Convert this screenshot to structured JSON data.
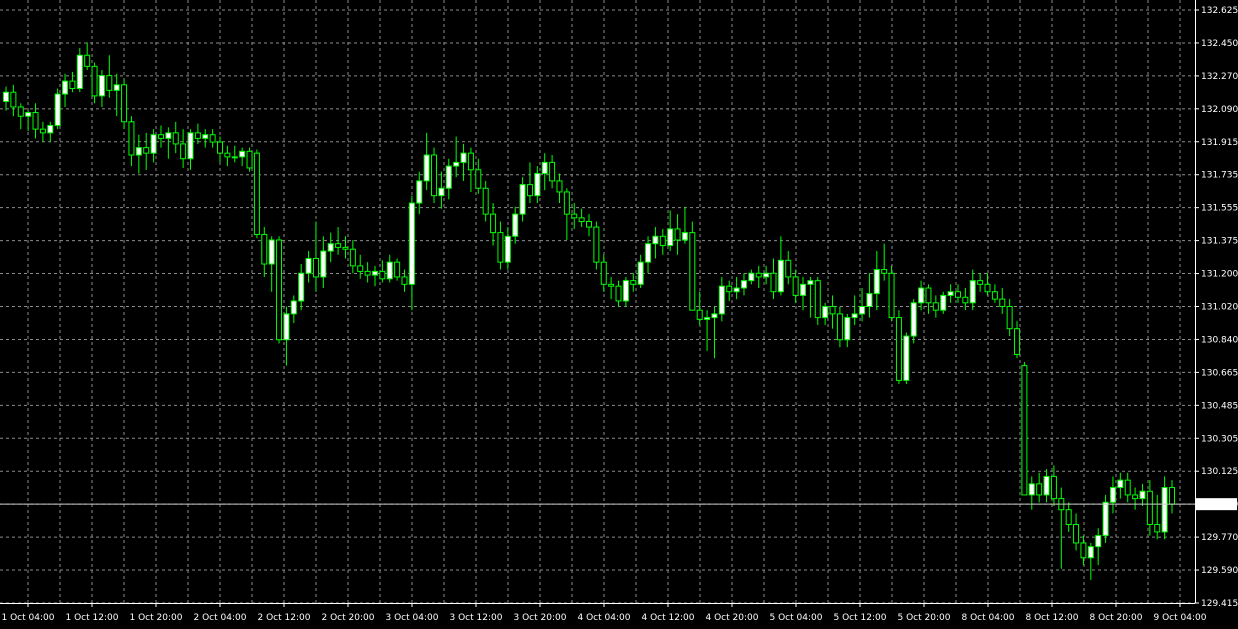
{
  "colors": {
    "background": "#000000",
    "grid": "#8c8c8c",
    "candle": "#00ff00",
    "bull_body": "#ffffff",
    "bear_body": "#000000",
    "axis_text": "#ffffff",
    "price_line": "#c8c8c8"
  },
  "chart_data": {
    "type": "candlestick",
    "title": "",
    "xlabel": "",
    "ylabel": "",
    "grid": true,
    "y_axis_side": "right",
    "ylim": [
      129.415,
      132.625
    ],
    "y_ticks": [
      "132.625",
      "132.450",
      "132.270",
      "132.090",
      "131.915",
      "131.735",
      "131.555",
      "131.375",
      "131.200",
      "131.020",
      "130.840",
      "130.665",
      "130.485",
      "130.305",
      "130.125",
      "129.950",
      "129.770",
      "129.590",
      "129.415"
    ],
    "x_ticks": [
      "1 Oct 04:00",
      "1 Oct 12:00",
      "1 Oct 20:00",
      "2 Oct 04:00",
      "2 Oct 12:00",
      "2 Oct 20:00",
      "3 Oct 04:00",
      "3 Oct 12:00",
      "3 Oct 20:00",
      "4 Oct 04:00",
      "4 Oct 12:00",
      "4 Oct 20:00",
      "5 Oct 04:00",
      "5 Oct 12:00",
      "5 Oct 20:00",
      "8 Oct 04:00",
      "8 Oct 12:00",
      "8 Oct 20:00",
      "9 Oct 04:00"
    ],
    "current_price": "129.950",
    "current_price_value": 129.95,
    "ohlc": [
      {
        "o": 132.13,
        "h": 132.21,
        "l": 132.08,
        "c": 132.18
      },
      {
        "o": 132.18,
        "h": 132.22,
        "l": 132.05,
        "c": 132.1
      },
      {
        "o": 132.1,
        "h": 132.12,
        "l": 131.98,
        "c": 132.05
      },
      {
        "o": 132.05,
        "h": 132.08,
        "l": 131.97,
        "c": 132.07
      },
      {
        "o": 132.07,
        "h": 132.12,
        "l": 131.93,
        "c": 131.98
      },
      {
        "o": 131.98,
        "h": 132.02,
        "l": 131.91,
        "c": 131.96
      },
      {
        "o": 131.96,
        "h": 132.02,
        "l": 131.91,
        "c": 132.0
      },
      {
        "o": 132.0,
        "h": 132.2,
        "l": 131.98,
        "c": 132.17
      },
      {
        "o": 132.17,
        "h": 132.28,
        "l": 132.1,
        "c": 132.24
      },
      {
        "o": 132.24,
        "h": 132.29,
        "l": 132.18,
        "c": 132.2
      },
      {
        "o": 132.2,
        "h": 132.42,
        "l": 132.18,
        "c": 132.38
      },
      {
        "o": 132.38,
        "h": 132.45,
        "l": 132.3,
        "c": 132.32
      },
      {
        "o": 132.32,
        "h": 132.34,
        "l": 132.12,
        "c": 132.16
      },
      {
        "o": 132.16,
        "h": 132.3,
        "l": 132.1,
        "c": 132.27
      },
      {
        "o": 132.27,
        "h": 132.38,
        "l": 132.15,
        "c": 132.19
      },
      {
        "o": 132.19,
        "h": 132.28,
        "l": 132.05,
        "c": 132.22
      },
      {
        "o": 132.22,
        "h": 132.25,
        "l": 131.98,
        "c": 132.02
      },
      {
        "o": 132.02,
        "h": 132.05,
        "l": 131.78,
        "c": 131.84
      },
      {
        "o": 131.84,
        "h": 131.95,
        "l": 131.74,
        "c": 131.88
      },
      {
        "o": 131.88,
        "h": 131.96,
        "l": 131.76,
        "c": 131.85
      },
      {
        "o": 131.85,
        "h": 131.98,
        "l": 131.8,
        "c": 131.95
      },
      {
        "o": 131.95,
        "h": 132.0,
        "l": 131.88,
        "c": 131.93
      },
      {
        "o": 131.93,
        "h": 131.99,
        "l": 131.82,
        "c": 131.96
      },
      {
        "o": 131.96,
        "h": 132.02,
        "l": 131.85,
        "c": 131.9
      },
      {
        "o": 131.9,
        "h": 131.98,
        "l": 131.77,
        "c": 131.82
      },
      {
        "o": 131.82,
        "h": 131.98,
        "l": 131.76,
        "c": 131.96
      },
      {
        "o": 131.96,
        "h": 132.01,
        "l": 131.9,
        "c": 131.93
      },
      {
        "o": 131.93,
        "h": 131.98,
        "l": 131.88,
        "c": 131.95
      },
      {
        "o": 131.95,
        "h": 131.98,
        "l": 131.88,
        "c": 131.91
      },
      {
        "o": 131.91,
        "h": 131.94,
        "l": 131.8,
        "c": 131.85
      },
      {
        "o": 131.85,
        "h": 131.89,
        "l": 131.78,
        "c": 131.83
      },
      {
        "o": 131.83,
        "h": 131.89,
        "l": 131.8,
        "c": 131.83
      },
      {
        "o": 131.83,
        "h": 131.88,
        "l": 131.78,
        "c": 131.86
      },
      {
        "o": 131.86,
        "h": 131.88,
        "l": 131.75,
        "c": 131.77
      },
      {
        "o": 131.85,
        "h": 131.87,
        "l": 131.39,
        "c": 131.41
      },
      {
        "o": 131.41,
        "h": 131.45,
        "l": 131.18,
        "c": 131.25
      },
      {
        "o": 131.25,
        "h": 131.4,
        "l": 131.1,
        "c": 131.38
      },
      {
        "o": 131.38,
        "h": 131.4,
        "l": 130.82,
        "c": 130.84
      },
      {
        "o": 130.84,
        "h": 131.02,
        "l": 130.7,
        "c": 130.98
      },
      {
        "o": 130.98,
        "h": 131.08,
        "l": 130.93,
        "c": 131.05
      },
      {
        "o": 131.05,
        "h": 131.25,
        "l": 131.0,
        "c": 131.2
      },
      {
        "o": 131.2,
        "h": 131.32,
        "l": 131.15,
        "c": 131.28
      },
      {
        "o": 131.28,
        "h": 131.48,
        "l": 131.1,
        "c": 131.18
      },
      {
        "o": 131.18,
        "h": 131.4,
        "l": 131.12,
        "c": 131.32
      },
      {
        "o": 131.32,
        "h": 131.42,
        "l": 131.26,
        "c": 131.36
      },
      {
        "o": 131.36,
        "h": 131.45,
        "l": 131.3,
        "c": 131.34
      },
      {
        "o": 131.34,
        "h": 131.4,
        "l": 131.28,
        "c": 131.33
      },
      {
        "o": 131.33,
        "h": 131.38,
        "l": 131.2,
        "c": 131.24
      },
      {
        "o": 131.24,
        "h": 131.3,
        "l": 131.17,
        "c": 131.21
      },
      {
        "o": 131.21,
        "h": 131.26,
        "l": 131.15,
        "c": 131.19
      },
      {
        "o": 131.19,
        "h": 131.24,
        "l": 131.13,
        "c": 131.21
      },
      {
        "o": 131.21,
        "h": 131.27,
        "l": 131.15,
        "c": 131.17
      },
      {
        "o": 131.17,
        "h": 131.3,
        "l": 131.15,
        "c": 131.26
      },
      {
        "o": 131.26,
        "h": 131.28,
        "l": 131.16,
        "c": 131.18
      },
      {
        "o": 131.18,
        "h": 131.22,
        "l": 131.1,
        "c": 131.14
      },
      {
        "o": 131.14,
        "h": 131.62,
        "l": 131.0,
        "c": 131.58
      },
      {
        "o": 131.58,
        "h": 131.75,
        "l": 131.52,
        "c": 131.7
      },
      {
        "o": 131.7,
        "h": 131.96,
        "l": 131.65,
        "c": 131.84
      },
      {
        "o": 131.84,
        "h": 131.88,
        "l": 131.58,
        "c": 131.62
      },
      {
        "o": 131.62,
        "h": 131.75,
        "l": 131.55,
        "c": 131.66
      },
      {
        "o": 131.66,
        "h": 131.82,
        "l": 131.6,
        "c": 131.78
      },
      {
        "o": 131.78,
        "h": 131.94,
        "l": 131.72,
        "c": 131.8
      },
      {
        "o": 131.8,
        "h": 131.9,
        "l": 131.7,
        "c": 131.85
      },
      {
        "o": 131.85,
        "h": 131.88,
        "l": 131.64,
        "c": 131.76
      },
      {
        "o": 131.76,
        "h": 131.82,
        "l": 131.63,
        "c": 131.66
      },
      {
        "o": 131.66,
        "h": 131.7,
        "l": 131.48,
        "c": 131.52
      },
      {
        "o": 131.52,
        "h": 131.58,
        "l": 131.35,
        "c": 131.42
      },
      {
        "o": 131.42,
        "h": 131.48,
        "l": 131.22,
        "c": 131.26
      },
      {
        "o": 131.26,
        "h": 131.45,
        "l": 131.22,
        "c": 131.4
      },
      {
        "o": 131.4,
        "h": 131.56,
        "l": 131.36,
        "c": 131.52
      },
      {
        "o": 131.52,
        "h": 131.72,
        "l": 131.48,
        "c": 131.68
      },
      {
        "o": 131.68,
        "h": 131.8,
        "l": 131.58,
        "c": 131.62
      },
      {
        "o": 131.62,
        "h": 131.78,
        "l": 131.58,
        "c": 131.74
      },
      {
        "o": 131.74,
        "h": 131.85,
        "l": 131.65,
        "c": 131.8
      },
      {
        "o": 131.8,
        "h": 131.84,
        "l": 131.66,
        "c": 131.7
      },
      {
        "o": 131.7,
        "h": 131.74,
        "l": 131.58,
        "c": 131.64
      },
      {
        "o": 131.64,
        "h": 131.66,
        "l": 131.38,
        "c": 131.52
      },
      {
        "o": 131.52,
        "h": 131.58,
        "l": 131.44,
        "c": 131.5
      },
      {
        "o": 131.5,
        "h": 131.55,
        "l": 131.45,
        "c": 131.48
      },
      {
        "o": 131.48,
        "h": 131.52,
        "l": 131.4,
        "c": 131.45
      },
      {
        "o": 131.45,
        "h": 131.48,
        "l": 131.22,
        "c": 131.26
      },
      {
        "o": 131.26,
        "h": 131.3,
        "l": 131.1,
        "c": 131.14
      },
      {
        "o": 131.14,
        "h": 131.18,
        "l": 131.06,
        "c": 131.13
      },
      {
        "o": 131.13,
        "h": 131.16,
        "l": 131.02,
        "c": 131.05
      },
      {
        "o": 131.05,
        "h": 131.18,
        "l": 131.02,
        "c": 131.16
      },
      {
        "o": 131.16,
        "h": 131.2,
        "l": 131.1,
        "c": 131.14
      },
      {
        "o": 131.14,
        "h": 131.3,
        "l": 131.12,
        "c": 131.26
      },
      {
        "o": 131.26,
        "h": 131.4,
        "l": 131.2,
        "c": 131.36
      },
      {
        "o": 131.36,
        "h": 131.45,
        "l": 131.28,
        "c": 131.4
      },
      {
        "o": 131.4,
        "h": 131.44,
        "l": 131.3,
        "c": 131.35
      },
      {
        "o": 131.35,
        "h": 131.54,
        "l": 131.32,
        "c": 131.44
      },
      {
        "o": 131.44,
        "h": 131.52,
        "l": 131.3,
        "c": 131.38
      },
      {
        "o": 131.38,
        "h": 131.56,
        "l": 131.36,
        "c": 131.42
      },
      {
        "o": 131.42,
        "h": 131.48,
        "l": 131.0,
        "c": 131.0
      },
      {
        "o": 131.0,
        "h": 131.1,
        "l": 130.92,
        "c": 130.95
      },
      {
        "o": 130.95,
        "h": 131.0,
        "l": 130.78,
        "c": 130.96
      },
      {
        "o": 130.96,
        "h": 131.02,
        "l": 130.74,
        "c": 130.98
      },
      {
        "o": 130.98,
        "h": 131.18,
        "l": 130.94,
        "c": 131.13
      },
      {
        "o": 131.13,
        "h": 131.16,
        "l": 131.05,
        "c": 131.1
      },
      {
        "o": 131.1,
        "h": 131.18,
        "l": 131.06,
        "c": 131.12
      },
      {
        "o": 131.12,
        "h": 131.2,
        "l": 131.08,
        "c": 131.16
      },
      {
        "o": 131.16,
        "h": 131.22,
        "l": 131.14,
        "c": 131.2
      },
      {
        "o": 131.2,
        "h": 131.24,
        "l": 131.12,
        "c": 131.18
      },
      {
        "o": 131.18,
        "h": 131.24,
        "l": 131.14,
        "c": 131.2
      },
      {
        "o": 131.2,
        "h": 131.28,
        "l": 131.06,
        "c": 131.1
      },
      {
        "o": 131.1,
        "h": 131.4,
        "l": 131.08,
        "c": 131.27
      },
      {
        "o": 131.27,
        "h": 131.32,
        "l": 131.14,
        "c": 131.18
      },
      {
        "o": 131.18,
        "h": 131.22,
        "l": 131.04,
        "c": 131.08
      },
      {
        "o": 131.08,
        "h": 131.18,
        "l": 131.0,
        "c": 131.14
      },
      {
        "o": 131.14,
        "h": 131.18,
        "l": 130.96,
        "c": 131.16
      },
      {
        "o": 131.16,
        "h": 131.18,
        "l": 130.92,
        "c": 130.96
      },
      {
        "o": 130.96,
        "h": 131.04,
        "l": 130.92,
        "c": 131.02
      },
      {
        "o": 131.02,
        "h": 131.08,
        "l": 130.9,
        "c": 130.98
      },
      {
        "o": 130.98,
        "h": 131.02,
        "l": 130.8,
        "c": 130.84
      },
      {
        "o": 130.84,
        "h": 130.98,
        "l": 130.8,
        "c": 130.96
      },
      {
        "o": 130.96,
        "h": 131.08,
        "l": 130.92,
        "c": 130.98
      },
      {
        "o": 130.98,
        "h": 131.12,
        "l": 130.94,
        "c": 131.02
      },
      {
        "o": 131.02,
        "h": 131.2,
        "l": 130.96,
        "c": 131.09
      },
      {
        "o": 131.09,
        "h": 131.32,
        "l": 131.0,
        "c": 131.22
      },
      {
        "o": 131.22,
        "h": 131.36,
        "l": 131.16,
        "c": 131.2
      },
      {
        "o": 131.2,
        "h": 131.24,
        "l": 130.94,
        "c": 130.96
      },
      {
        "o": 130.96,
        "h": 131.0,
        "l": 130.6,
        "c": 130.62
      },
      {
        "o": 130.62,
        "h": 130.88,
        "l": 130.6,
        "c": 130.86
      },
      {
        "o": 130.86,
        "h": 131.06,
        "l": 130.82,
        "c": 131.04
      },
      {
        "o": 131.04,
        "h": 131.16,
        "l": 131.0,
        "c": 131.12
      },
      {
        "o": 131.12,
        "h": 131.14,
        "l": 130.98,
        "c": 131.04
      },
      {
        "o": 131.04,
        "h": 131.08,
        "l": 130.96,
        "c": 131.0
      },
      {
        "o": 131.0,
        "h": 131.1,
        "l": 130.98,
        "c": 131.08
      },
      {
        "o": 131.08,
        "h": 131.14,
        "l": 131.04,
        "c": 131.1
      },
      {
        "o": 131.1,
        "h": 131.14,
        "l": 131.04,
        "c": 131.07
      },
      {
        "o": 131.07,
        "h": 131.12,
        "l": 131.0,
        "c": 131.04
      },
      {
        "o": 131.04,
        "h": 131.22,
        "l": 131.0,
        "c": 131.16
      },
      {
        "o": 131.16,
        "h": 131.2,
        "l": 131.1,
        "c": 131.14
      },
      {
        "o": 131.14,
        "h": 131.2,
        "l": 131.08,
        "c": 131.1
      },
      {
        "o": 131.1,
        "h": 131.14,
        "l": 131.04,
        "c": 131.06
      },
      {
        "o": 131.06,
        "h": 131.12,
        "l": 130.98,
        "c": 131.02
      },
      {
        "o": 131.02,
        "h": 131.06,
        "l": 130.86,
        "c": 130.9
      },
      {
        "o": 130.9,
        "h": 130.94,
        "l": 130.74,
        "c": 130.76
      },
      {
        "o": 130.7,
        "h": 130.72,
        "l": 130.05,
        "c": 130.0
      },
      {
        "o": 130.0,
        "h": 130.1,
        "l": 129.92,
        "c": 130.06
      },
      {
        "o": 130.06,
        "h": 130.12,
        "l": 129.96,
        "c": 130.0
      },
      {
        "o": 130.0,
        "h": 130.14,
        "l": 129.96,
        "c": 130.1
      },
      {
        "o": 130.1,
        "h": 130.16,
        "l": 129.94,
        "c": 129.98
      },
      {
        "o": 129.98,
        "h": 130.04,
        "l": 129.6,
        "c": 129.92
      },
      {
        "o": 129.92,
        "h": 129.96,
        "l": 129.8,
        "c": 129.84
      },
      {
        "o": 129.84,
        "h": 129.9,
        "l": 129.7,
        "c": 129.74
      },
      {
        "o": 129.74,
        "h": 129.78,
        "l": 129.62,
        "c": 129.66
      },
      {
        "o": 129.66,
        "h": 129.74,
        "l": 129.54,
        "c": 129.72
      },
      {
        "o": 129.72,
        "h": 129.82,
        "l": 129.62,
        "c": 129.78
      },
      {
        "o": 129.78,
        "h": 130.0,
        "l": 129.74,
        "c": 129.96
      },
      {
        "o": 129.96,
        "h": 130.1,
        "l": 129.9,
        "c": 130.04
      },
      {
        "o": 130.04,
        "h": 130.12,
        "l": 129.98,
        "c": 130.08
      },
      {
        "o": 130.08,
        "h": 130.12,
        "l": 129.96,
        "c": 130.0
      },
      {
        "o": 130.0,
        "h": 130.04,
        "l": 129.92,
        "c": 129.98
      },
      {
        "o": 129.98,
        "h": 130.06,
        "l": 129.94,
        "c": 130.02
      },
      {
        "o": 130.02,
        "h": 130.08,
        "l": 129.78,
        "c": 129.84
      },
      {
        "o": 129.84,
        "h": 130.0,
        "l": 129.76,
        "c": 129.8
      },
      {
        "o": 129.8,
        "h": 130.1,
        "l": 129.76,
        "c": 130.04
      },
      {
        "o": 130.04,
        "h": 130.08,
        "l": 129.9,
        "c": 129.95
      }
    ]
  }
}
